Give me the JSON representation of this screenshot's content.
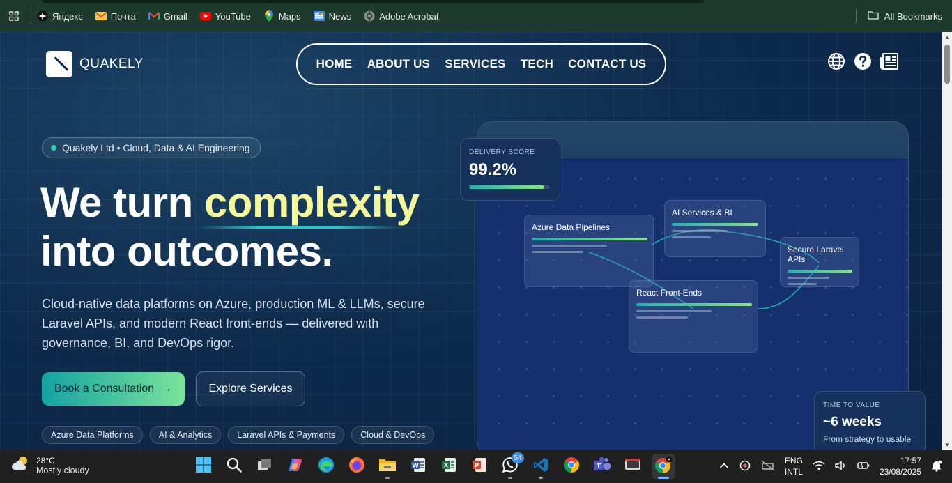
{
  "bookmarks": {
    "items": [
      {
        "label": "Яндекс",
        "icon": "yandex-icon"
      },
      {
        "label": "Почта",
        "icon": "mail-icon"
      },
      {
        "label": "Gmail",
        "icon": "gmail-icon"
      },
      {
        "label": "YouTube",
        "icon": "youtube-icon"
      },
      {
        "label": "Maps",
        "icon": "maps-icon"
      },
      {
        "label": "News",
        "icon": "news-icon"
      },
      {
        "label": "Adobe Acrobat",
        "icon": "acrobat-icon"
      }
    ],
    "all_bookmarks": "All Bookmarks"
  },
  "site": {
    "brand": "QUAKELY",
    "nav": [
      "HOME",
      "ABOUT US",
      "SERVICES",
      "TECH",
      "CONTACT US"
    ],
    "header_icons": [
      "globe-icon",
      "help-icon",
      "newspaper-icon"
    ]
  },
  "hero": {
    "pill": "Quakely Ltd • Cloud, Data & AI Engineering",
    "headline_line1_prefix": "We turn ",
    "headline_highlight": "complexity",
    "headline_line2": "into outcomes.",
    "lede": "Cloud-native data platforms on Azure, production ML & LLMs, secure Laravel APIs, and modern React front-ends — delivered with governance, BI, and DevOps rigor.",
    "cta_primary": "Book a Consultation",
    "cta_primary_arrow": "→",
    "cta_secondary": "Explore Services",
    "tags": [
      "Azure Data Platforms",
      "AI & Analytics",
      "Laravel APIs & Payments",
      "Cloud & DevOps"
    ]
  },
  "dashboard": {
    "delivery_label": "DELIVERY SCORE",
    "delivery_value": "99.2%",
    "delivery_progress": 0.93,
    "cards": [
      {
        "title": "Azure Data Pipelines"
      },
      {
        "title": "AI Services & BI"
      },
      {
        "title": "Secure Laravel APIs"
      },
      {
        "title": "React Front-Ends"
      }
    ],
    "ttv_label": "TIME TO VALUE",
    "ttv_value": "~6 weeks",
    "ttv_sub": "From strategy to usable"
  },
  "taskbar": {
    "temperature": "28°C",
    "weather": "Mostly cloudy",
    "whatsapp_badge": "54",
    "lang_line1": "ENG",
    "lang_line2": "INTL",
    "time": "17:57",
    "date": "23/08/2025"
  },
  "colors": {
    "accent_teal": "#14a3a3",
    "accent_green": "#7be39a",
    "highlight_yellow": "#f4f79a",
    "bookmark_bar": "#1e3a2f"
  }
}
